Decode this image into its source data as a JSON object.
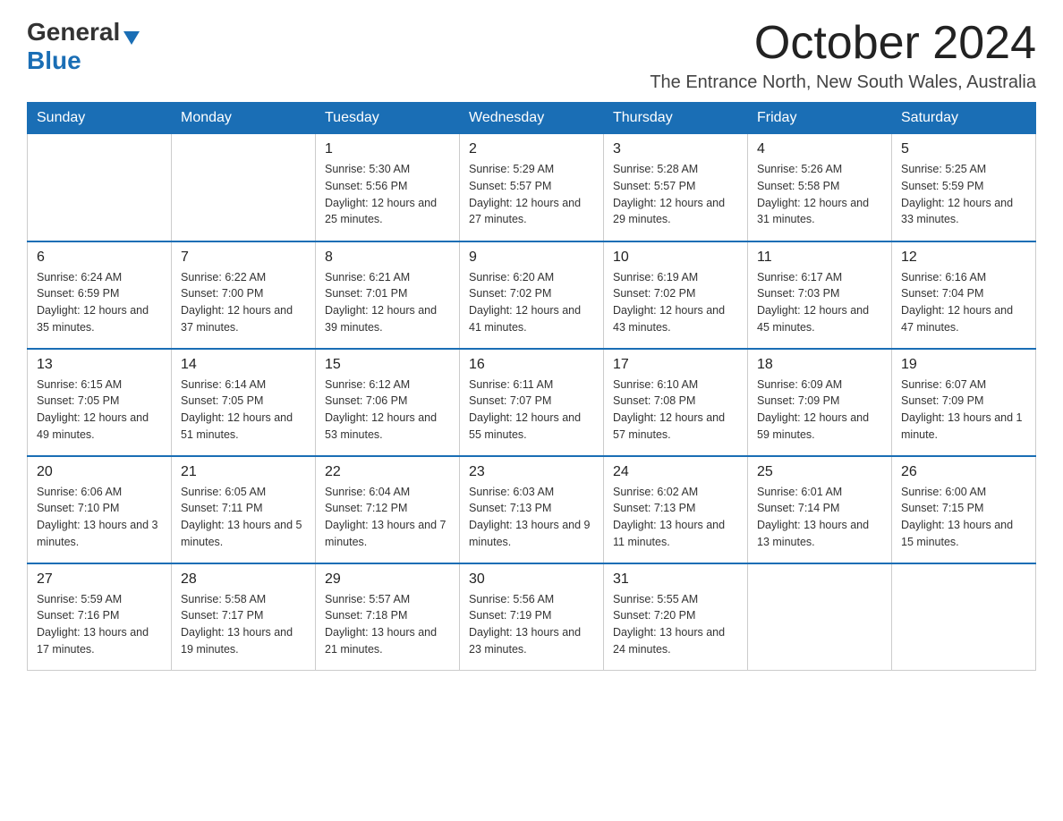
{
  "header": {
    "logo_general": "General",
    "logo_blue": "Blue",
    "title": "October 2024",
    "subtitle": "The Entrance North, New South Wales, Australia"
  },
  "days_of_week": [
    "Sunday",
    "Monday",
    "Tuesday",
    "Wednesday",
    "Thursday",
    "Friday",
    "Saturday"
  ],
  "weeks": [
    [
      {
        "day": "",
        "sunrise": "",
        "sunset": "",
        "daylight": ""
      },
      {
        "day": "",
        "sunrise": "",
        "sunset": "",
        "daylight": ""
      },
      {
        "day": "1",
        "sunrise": "Sunrise: 5:30 AM",
        "sunset": "Sunset: 5:56 PM",
        "daylight": "Daylight: 12 hours and 25 minutes."
      },
      {
        "day": "2",
        "sunrise": "Sunrise: 5:29 AM",
        "sunset": "Sunset: 5:57 PM",
        "daylight": "Daylight: 12 hours and 27 minutes."
      },
      {
        "day": "3",
        "sunrise": "Sunrise: 5:28 AM",
        "sunset": "Sunset: 5:57 PM",
        "daylight": "Daylight: 12 hours and 29 minutes."
      },
      {
        "day": "4",
        "sunrise": "Sunrise: 5:26 AM",
        "sunset": "Sunset: 5:58 PM",
        "daylight": "Daylight: 12 hours and 31 minutes."
      },
      {
        "day": "5",
        "sunrise": "Sunrise: 5:25 AM",
        "sunset": "Sunset: 5:59 PM",
        "daylight": "Daylight: 12 hours and 33 minutes."
      }
    ],
    [
      {
        "day": "6",
        "sunrise": "Sunrise: 6:24 AM",
        "sunset": "Sunset: 6:59 PM",
        "daylight": "Daylight: 12 hours and 35 minutes."
      },
      {
        "day": "7",
        "sunrise": "Sunrise: 6:22 AM",
        "sunset": "Sunset: 7:00 PM",
        "daylight": "Daylight: 12 hours and 37 minutes."
      },
      {
        "day": "8",
        "sunrise": "Sunrise: 6:21 AM",
        "sunset": "Sunset: 7:01 PM",
        "daylight": "Daylight: 12 hours and 39 minutes."
      },
      {
        "day": "9",
        "sunrise": "Sunrise: 6:20 AM",
        "sunset": "Sunset: 7:02 PM",
        "daylight": "Daylight: 12 hours and 41 minutes."
      },
      {
        "day": "10",
        "sunrise": "Sunrise: 6:19 AM",
        "sunset": "Sunset: 7:02 PM",
        "daylight": "Daylight: 12 hours and 43 minutes."
      },
      {
        "day": "11",
        "sunrise": "Sunrise: 6:17 AM",
        "sunset": "Sunset: 7:03 PM",
        "daylight": "Daylight: 12 hours and 45 minutes."
      },
      {
        "day": "12",
        "sunrise": "Sunrise: 6:16 AM",
        "sunset": "Sunset: 7:04 PM",
        "daylight": "Daylight: 12 hours and 47 minutes."
      }
    ],
    [
      {
        "day": "13",
        "sunrise": "Sunrise: 6:15 AM",
        "sunset": "Sunset: 7:05 PM",
        "daylight": "Daylight: 12 hours and 49 minutes."
      },
      {
        "day": "14",
        "sunrise": "Sunrise: 6:14 AM",
        "sunset": "Sunset: 7:05 PM",
        "daylight": "Daylight: 12 hours and 51 minutes."
      },
      {
        "day": "15",
        "sunrise": "Sunrise: 6:12 AM",
        "sunset": "Sunset: 7:06 PM",
        "daylight": "Daylight: 12 hours and 53 minutes."
      },
      {
        "day": "16",
        "sunrise": "Sunrise: 6:11 AM",
        "sunset": "Sunset: 7:07 PM",
        "daylight": "Daylight: 12 hours and 55 minutes."
      },
      {
        "day": "17",
        "sunrise": "Sunrise: 6:10 AM",
        "sunset": "Sunset: 7:08 PM",
        "daylight": "Daylight: 12 hours and 57 minutes."
      },
      {
        "day": "18",
        "sunrise": "Sunrise: 6:09 AM",
        "sunset": "Sunset: 7:09 PM",
        "daylight": "Daylight: 12 hours and 59 minutes."
      },
      {
        "day": "19",
        "sunrise": "Sunrise: 6:07 AM",
        "sunset": "Sunset: 7:09 PM",
        "daylight": "Daylight: 13 hours and 1 minute."
      }
    ],
    [
      {
        "day": "20",
        "sunrise": "Sunrise: 6:06 AM",
        "sunset": "Sunset: 7:10 PM",
        "daylight": "Daylight: 13 hours and 3 minutes."
      },
      {
        "day": "21",
        "sunrise": "Sunrise: 6:05 AM",
        "sunset": "Sunset: 7:11 PM",
        "daylight": "Daylight: 13 hours and 5 minutes."
      },
      {
        "day": "22",
        "sunrise": "Sunrise: 6:04 AM",
        "sunset": "Sunset: 7:12 PM",
        "daylight": "Daylight: 13 hours and 7 minutes."
      },
      {
        "day": "23",
        "sunrise": "Sunrise: 6:03 AM",
        "sunset": "Sunset: 7:13 PM",
        "daylight": "Daylight: 13 hours and 9 minutes."
      },
      {
        "day": "24",
        "sunrise": "Sunrise: 6:02 AM",
        "sunset": "Sunset: 7:13 PM",
        "daylight": "Daylight: 13 hours and 11 minutes."
      },
      {
        "day": "25",
        "sunrise": "Sunrise: 6:01 AM",
        "sunset": "Sunset: 7:14 PM",
        "daylight": "Daylight: 13 hours and 13 minutes."
      },
      {
        "day": "26",
        "sunrise": "Sunrise: 6:00 AM",
        "sunset": "Sunset: 7:15 PM",
        "daylight": "Daylight: 13 hours and 15 minutes."
      }
    ],
    [
      {
        "day": "27",
        "sunrise": "Sunrise: 5:59 AM",
        "sunset": "Sunset: 7:16 PM",
        "daylight": "Daylight: 13 hours and 17 minutes."
      },
      {
        "day": "28",
        "sunrise": "Sunrise: 5:58 AM",
        "sunset": "Sunset: 7:17 PM",
        "daylight": "Daylight: 13 hours and 19 minutes."
      },
      {
        "day": "29",
        "sunrise": "Sunrise: 5:57 AM",
        "sunset": "Sunset: 7:18 PM",
        "daylight": "Daylight: 13 hours and 21 minutes."
      },
      {
        "day": "30",
        "sunrise": "Sunrise: 5:56 AM",
        "sunset": "Sunset: 7:19 PM",
        "daylight": "Daylight: 13 hours and 23 minutes."
      },
      {
        "day": "31",
        "sunrise": "Sunrise: 5:55 AM",
        "sunset": "Sunset: 7:20 PM",
        "daylight": "Daylight: 13 hours and 24 minutes."
      },
      {
        "day": "",
        "sunrise": "",
        "sunset": "",
        "daylight": ""
      },
      {
        "day": "",
        "sunrise": "",
        "sunset": "",
        "daylight": ""
      }
    ]
  ]
}
